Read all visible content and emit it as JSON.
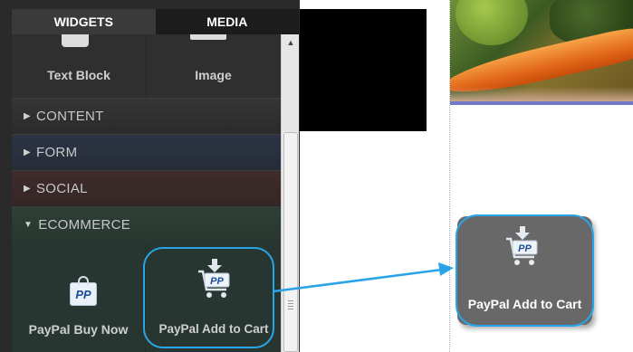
{
  "tabs": {
    "widgets": "WIDGETS",
    "media": "MEDIA"
  },
  "tiles": {
    "text_block": "Text Block",
    "image": "Image",
    "paypal_buy_now": "PayPal Buy Now",
    "paypal_add_to_cart": "PayPal Add to Cart"
  },
  "sections": {
    "content": "CONTENT",
    "form": "FORM",
    "social": "SOCIAL",
    "ecommerce": "ECOMMERCE"
  },
  "icons": {
    "collapsed_caret": "▶",
    "expanded_caret": "▼",
    "paypal_mark": "PP",
    "scroll_up": "▲"
  },
  "canvas": {
    "dragged_widget_label": "PayPal Add to Cart"
  },
  "colors": {
    "highlight": "#2aa4e8",
    "form_section": "#2c3444",
    "social_section": "#3f2c2c",
    "ecommerce_section": "#2d3f37"
  }
}
